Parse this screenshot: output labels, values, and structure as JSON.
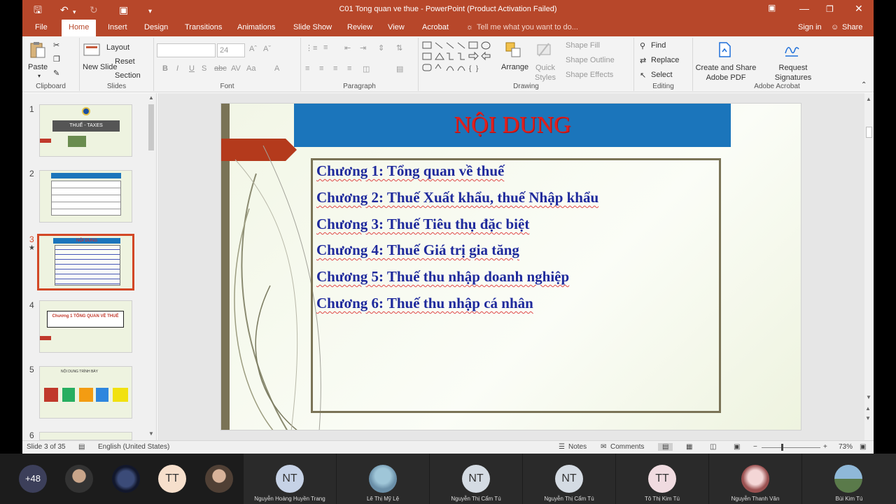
{
  "window": {
    "title": "C01 Tong quan ve thue - PowerPoint (Product Activation Failed)"
  },
  "tabs": [
    "File",
    "Home",
    "Insert",
    "Design",
    "Transitions",
    "Animations",
    "Slide Show",
    "Review",
    "View",
    "Acrobat"
  ],
  "active_tab": "Home",
  "tell_me": "Tell me what you want to do...",
  "sign_in": "Sign in",
  "share": "Share",
  "ribbon": {
    "clipboard": {
      "paste": "Paste",
      "label": "Clipboard"
    },
    "slides": {
      "new_slide": "New Slide",
      "layout": "Layout",
      "reset": "Reset",
      "section": "Section",
      "label": "Slides"
    },
    "font": {
      "size": "24",
      "label": "Font"
    },
    "paragraph": {
      "label": "Paragraph"
    },
    "drawing": {
      "arrange": "Arrange",
      "quick_styles": "Quick Styles",
      "shape_fill": "Shape Fill",
      "shape_outline": "Shape Outline",
      "shape_effects": "Shape Effects",
      "label": "Drawing"
    },
    "editing": {
      "find": "Find",
      "replace": "Replace",
      "select": "Select",
      "label": "Editing"
    },
    "acrobat": {
      "create_share": "Create and Share Adobe PDF",
      "request_signatures": "Request Signatures",
      "label": "Adobe Acrobat"
    }
  },
  "thumbnails": [
    {
      "num": "1",
      "title": "THUẾ - TAXES"
    },
    {
      "num": "2",
      "title": ""
    },
    {
      "num": "3",
      "title": "NỘI DUNG"
    },
    {
      "num": "4",
      "title": "Chương 1 TỔNG QUAN VỀ THUẾ"
    },
    {
      "num": "5",
      "title": "NỘI DUNG TRÌNH BÀY"
    },
    {
      "num": "6",
      "title": ""
    }
  ],
  "slide": {
    "title": "NỘI DUNG",
    "chapters": [
      "Chương 1: Tổng quan về thuế",
      "Chương 2: Thuế Xuất khẩu, thuế Nhập khẩu",
      "Chương 3: Thuế Tiêu thụ đặc biệt",
      "Chương 4: Thuế Giá trị gia tăng",
      "Chương 5: Thuế thu nhập doanh nghiệp",
      "Chương 6: Thuế thu nhập cá nhân"
    ]
  },
  "status": {
    "slide_info": "Slide 3 of 35",
    "language": "English (United States)",
    "notes": "Notes",
    "comments": "Comments",
    "zoom": "73%"
  },
  "meeting": {
    "more_count": "+48",
    "initials_tile": "TT",
    "participants": [
      {
        "name": "Nguyễn Hoàng Huyền Trang",
        "initials": "NT"
      },
      {
        "name": "Lê Thị Mỹ Lệ",
        "initials": ""
      },
      {
        "name": "Nguyễn Thị Cẩm Tú",
        "initials": "NT"
      },
      {
        "name": "Nguyễn Thị Cẩm Tú",
        "initials": "NT"
      },
      {
        "name": "Tô Thị Kim Tú",
        "initials": "TT"
      },
      {
        "name": "Nguyễn Thanh Vân",
        "initials": ""
      },
      {
        "name": "Bùi Kim Tú",
        "initials": ""
      }
    ]
  },
  "colors": {
    "accent": "#b7472a",
    "title_red": "#e0201e",
    "title_bar": "#1b75bb",
    "chapter_text": "#1f2a9c"
  }
}
